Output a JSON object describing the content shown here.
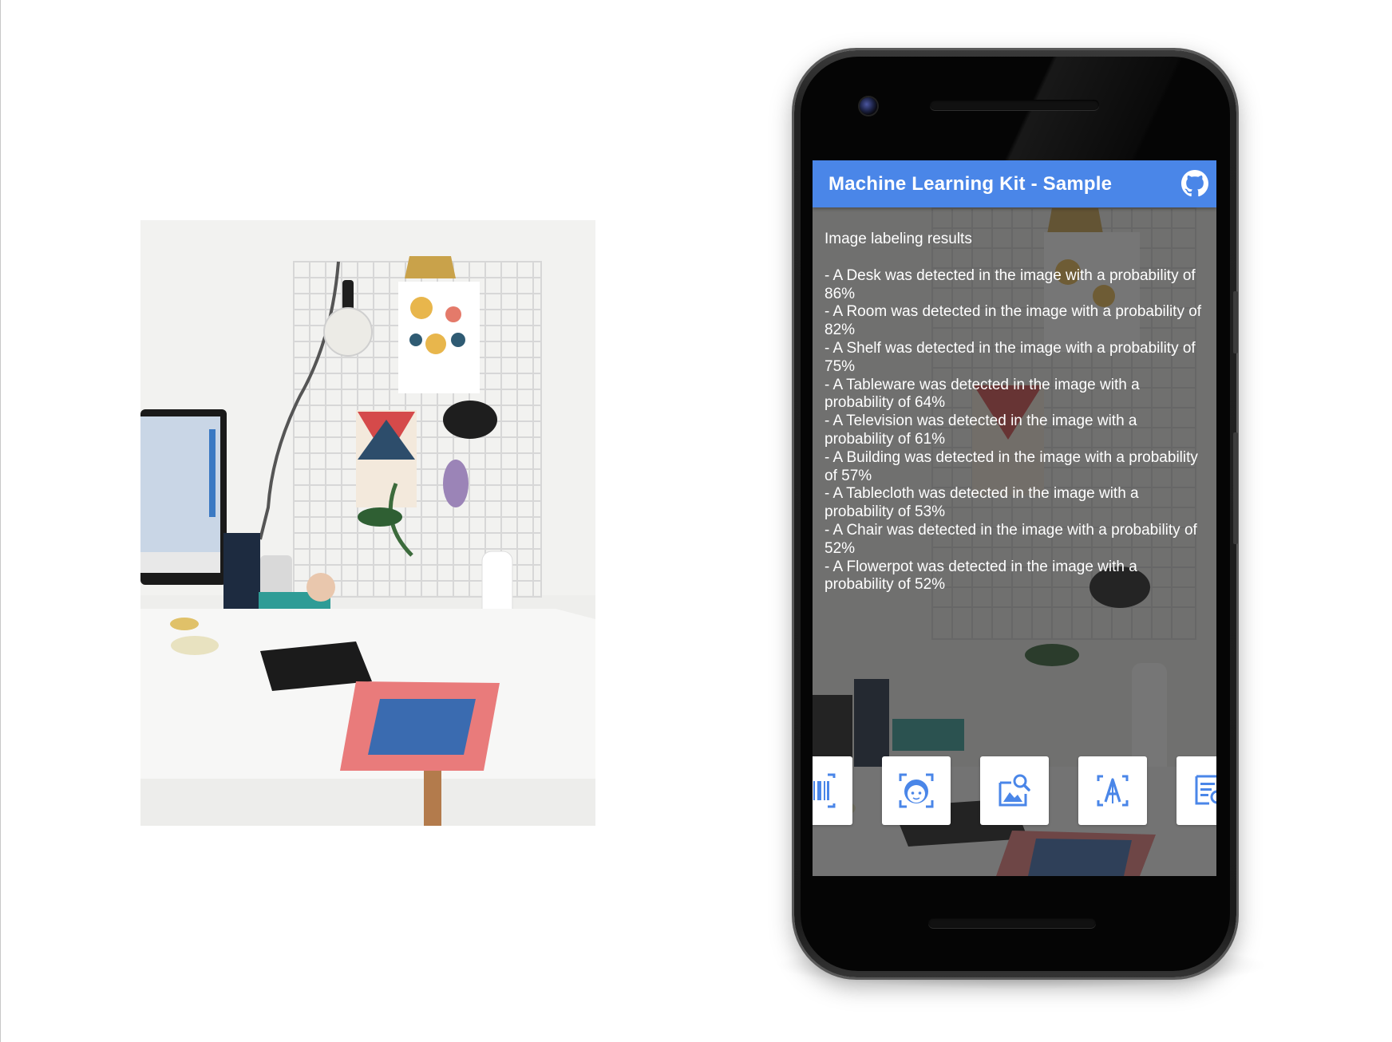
{
  "app": {
    "title": "Machine Learning Kit - Sample",
    "accent_color": "#4a86e8",
    "github_icon": "github-icon"
  },
  "results": {
    "heading": "Image labeling results",
    "lines": [
      "- A Desk was detected in the image with a probability of 86%",
      "- A Room was detected in the image with a probability of 82%",
      "- A Shelf was detected in the image with a probability of 75%",
      "- A Tableware was detected in the image with a probability of 64%",
      "- A Television was detected in the image with a probability of 61%",
      "- A Building was detected in the image with a probability of 57%",
      "- A Tablecloth was detected in the image with a probability of 53%",
      "- A Chair was detected in the image with a probability of 52%",
      "- A Flowerpot was detected in the image with a probability of 52%"
    ]
  },
  "tools": [
    {
      "icon": "barcode-scan-icon"
    },
    {
      "icon": "face-detection-icon"
    },
    {
      "icon": "image-labeling-icon"
    },
    {
      "icon": "text-recognition-icon"
    },
    {
      "icon": "document-scan-icon"
    }
  ]
}
